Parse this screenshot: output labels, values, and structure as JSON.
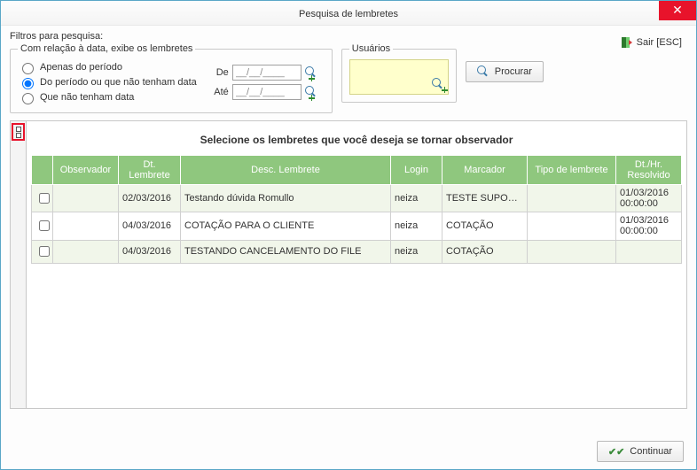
{
  "window": {
    "title": "Pesquisa de lembretes",
    "close": "✕"
  },
  "exit": {
    "label": "Sair [ESC]"
  },
  "filters": {
    "label": "Filtros para pesquisa:",
    "date_group": {
      "legend": "Com relação à data, exibe os lembretes",
      "options": {
        "only_period": "Apenas do período",
        "period_or_nodate": "Do período ou que não tenham data",
        "no_date": "Que não tenham data"
      },
      "from_label": "De",
      "to_label": "Até",
      "from_value": "__/__/____",
      "to_value": "__/__/____"
    },
    "users_group": {
      "legend": "Usuários"
    },
    "search_button": "Procurar"
  },
  "grid": {
    "title": "Selecione os lembretes que você deseja se tornar observador",
    "headers": {
      "chk": "",
      "observador": "Observador",
      "dt_lembrete": "Dt. Lembrete",
      "desc": "Desc. Lembrete",
      "login": "Login",
      "marcador": "Marcador",
      "tipo": "Tipo de lembrete",
      "dthr": "Dt./Hr. Resolvido"
    },
    "rows": [
      {
        "observador": "",
        "dt": "02/03/2016",
        "desc": "Testando dúvida Romullo",
        "login": "neiza",
        "marcador": "TESTE SUPORTE",
        "tipo": "",
        "dthr": "01/03/2016 00:00:00"
      },
      {
        "observador": "",
        "dt": "04/03/2016",
        "desc": "COTAÇÃO PARA O CLIENTE",
        "login": "neiza",
        "marcador": "COTAÇÃO",
        "tipo": "",
        "dthr": "01/03/2016 00:00:00"
      },
      {
        "observador": "",
        "dt": "04/03/2016",
        "desc": "TESTANDO CANCELAMENTO DO FILE",
        "login": "neiza",
        "marcador": "COTAÇÃO",
        "tipo": "",
        "dthr": ""
      }
    ]
  },
  "footer": {
    "continue": "Continuar"
  }
}
